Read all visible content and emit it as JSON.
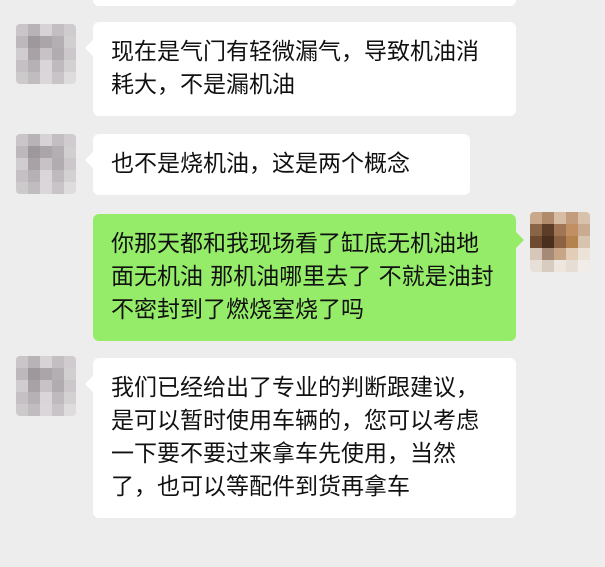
{
  "messages": [
    {
      "side": "left",
      "text": "现在是气门有轻微漏气，导致机油消耗大，不是漏机油"
    },
    {
      "side": "left",
      "text": "也不是烧机油，这是两个概念"
    },
    {
      "side": "right",
      "text": "你那天都和我现场看了缸底无机油地面无机油 那机油哪里去了 不就是油封不密封到了燃烧室烧了吗"
    },
    {
      "side": "left",
      "text": "我们已经给出了专业的判断跟建议，是可以暂时使用车辆的，您可以考虑一下要不要过来拿车先使用，当然了，也可以等配件到货再拿车"
    }
  ],
  "colors": {
    "background": "#ededed",
    "incoming_bubble": "#ffffff",
    "outgoing_bubble": "#95ec69",
    "text": "#111111"
  }
}
